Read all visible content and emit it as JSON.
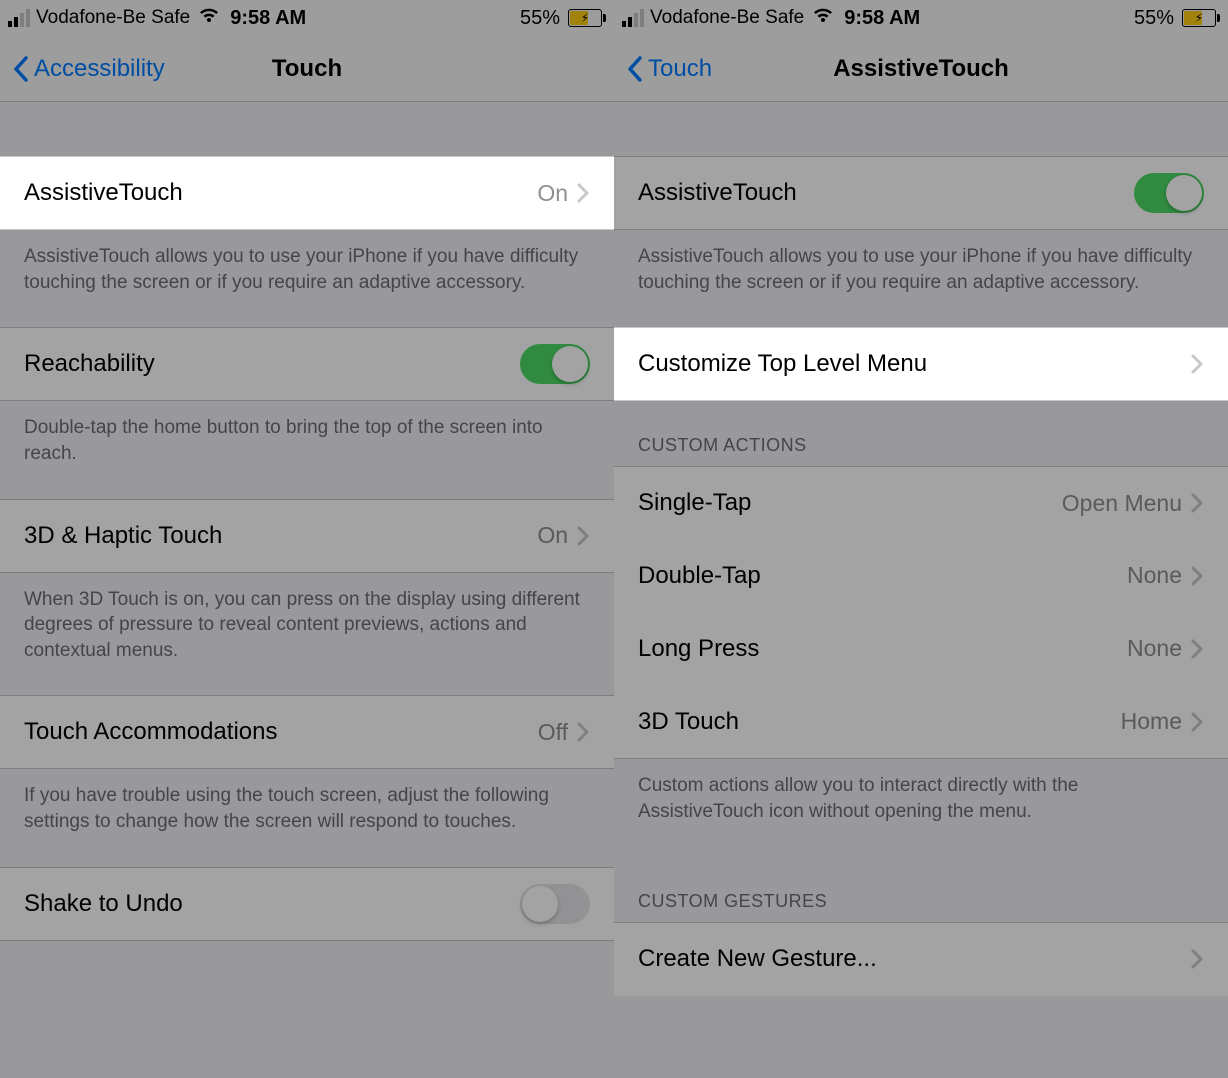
{
  "status": {
    "carrier": "Vodafone-Be Safe",
    "time": "9:58 AM",
    "battery_pct": "55%"
  },
  "left": {
    "back_label": "Accessibility",
    "nav_title": "Touch",
    "rows": {
      "assistive_touch_label": "AssistiveTouch",
      "assistive_touch_value": "On",
      "assistive_touch_desc": "AssistiveTouch allows you to use your iPhone if you have difficulty touching the screen or if you require an adaptive accessory.",
      "reachability_label": "Reachability",
      "reachability_desc": "Double-tap the home button to bring the top of the screen into reach.",
      "haptic_label": "3D & Haptic Touch",
      "haptic_value": "On",
      "haptic_desc": "When 3D Touch is on, you can press on the display using different degrees of pressure to reveal content previews, actions and contextual menus.",
      "touch_acc_label": "Touch Accommodations",
      "touch_acc_value": "Off",
      "touch_acc_desc": "If you have trouble using the touch screen, adjust the following settings to change how the screen will respond to touches.",
      "shake_label": "Shake to Undo"
    }
  },
  "right": {
    "back_label": "Touch",
    "nav_title": "AssistiveTouch",
    "rows": {
      "assistive_touch_label": "AssistiveTouch",
      "assistive_touch_desc": "AssistiveTouch allows you to use your iPhone if you have difficulty touching the screen or if you require an adaptive accessory.",
      "customize_label": "Customize Top Level Menu",
      "section_custom_actions": "CUSTOM ACTIONS",
      "single_tap_label": "Single-Tap",
      "single_tap_value": "Open Menu",
      "double_tap_label": "Double-Tap",
      "double_tap_value": "None",
      "long_press_label": "Long Press",
      "long_press_value": "None",
      "threed_label": "3D Touch",
      "threed_value": "Home",
      "custom_actions_desc": "Custom actions allow you to interact directly with the AssistiveTouch icon without opening the menu.",
      "section_custom_gestures": "CUSTOM GESTURES",
      "create_gesture_label": "Create New Gesture..."
    }
  }
}
